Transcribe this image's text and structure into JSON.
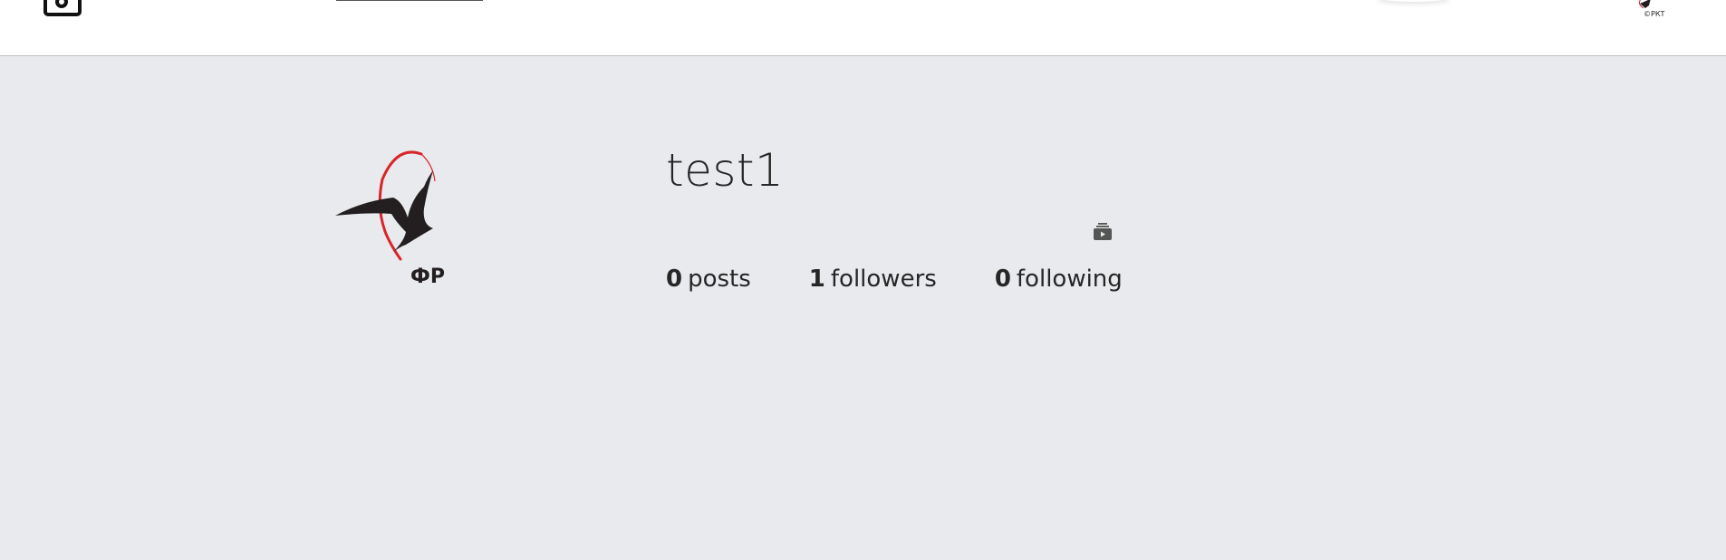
{
  "header": {
    "home_icon": "instagram-camera-icon",
    "search": {
      "value": "",
      "placeholder": ""
    },
    "account_avatar_caption": "©РКТ"
  },
  "profile": {
    "username": "test1",
    "avatar_logo_text": "ФР",
    "igtv_icon": "igtv-tv-icon",
    "stats": [
      {
        "count": "0",
        "label": "posts"
      },
      {
        "count": "1",
        "label": "followers"
      },
      {
        "count": "0",
        "label": "following"
      }
    ]
  },
  "colors": {
    "page_background": "#e9eaee",
    "header_background": "#ffffff",
    "logo_red": "#d8262b",
    "logo_black": "#231f20"
  }
}
